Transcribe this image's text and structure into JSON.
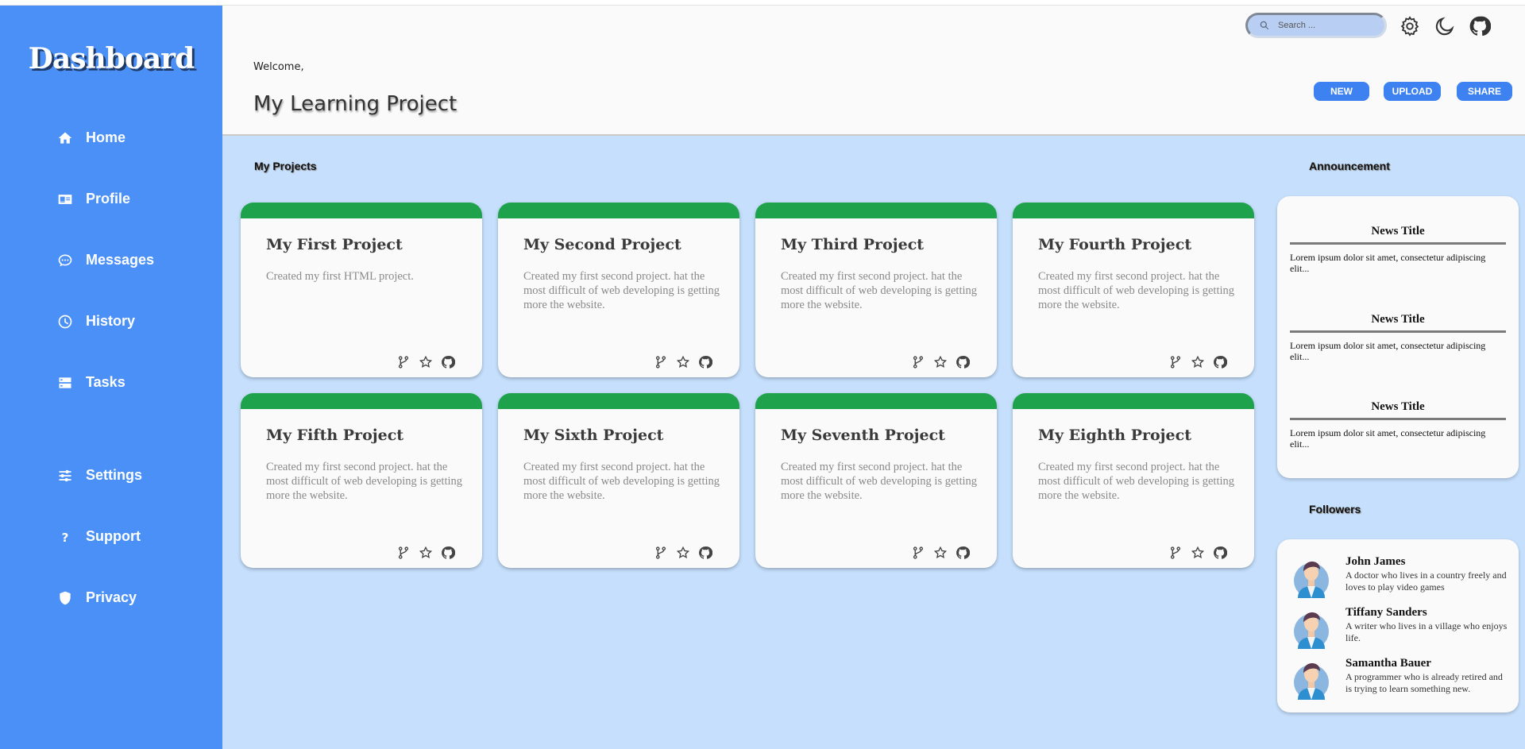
{
  "sidebar": {
    "logo": "Dashboard",
    "items": [
      {
        "label": "Home",
        "icon": "home-icon"
      },
      {
        "label": "Profile",
        "icon": "id-card-icon"
      },
      {
        "label": "Messages",
        "icon": "chat-icon"
      },
      {
        "label": "History",
        "icon": "clock-icon"
      },
      {
        "label": "Tasks",
        "icon": "tasks-icon"
      },
      {
        "label": "Settings",
        "icon": "sliders-icon"
      },
      {
        "label": "Support",
        "icon": "question-icon"
      },
      {
        "label": "Privacy",
        "icon": "shield-icon"
      }
    ]
  },
  "header": {
    "search_placeholder": "Search ...",
    "welcome": "Welcome,",
    "title": "My Learning Project",
    "buttons": [
      "NEW",
      "UPLOAD",
      "SHARE"
    ]
  },
  "projects": {
    "title": "My Projects",
    "items": [
      {
        "title": "My First Project",
        "desc": "Created my first HTML project."
      },
      {
        "title": "My Second Project",
        "desc": "Created my first second project. hat the most difficult of web developing is getting more the website."
      },
      {
        "title": "My Third Project",
        "desc": "Created my first second project. hat the most difficult of web developing is getting more the website."
      },
      {
        "title": "My Fourth Project",
        "desc": "Created my first second project. hat the most difficult of web developing is getting more the website."
      },
      {
        "title": "My Fifth Project",
        "desc": "Created my first second project. hat the most difficult of web developing is getting more the website."
      },
      {
        "title": "My Sixth Project",
        "desc": "Created my first second project. hat the most difficult of web developing is getting more the website."
      },
      {
        "title": "My Seventh Project",
        "desc": "Created my first second project. hat the most difficult of web developing is getting more the website."
      },
      {
        "title": "My Eighth Project",
        "desc": "Created my first second project. hat the most difficult of web developing is getting more the website."
      }
    ]
  },
  "announcement": {
    "title": "Announcement",
    "items": [
      {
        "title": "News Title",
        "body": "Lorem ipsum dolor sit amet, consectetur adipiscing elit..."
      },
      {
        "title": "News Title",
        "body": "Lorem ipsum dolor sit amet, consectetur adipiscing elit..."
      },
      {
        "title": "News Title",
        "body": "Lorem ipsum dolor sit amet, consectetur adipiscing elit..."
      }
    ]
  },
  "followers": {
    "title": "Followers",
    "items": [
      {
        "name": "John James",
        "desc": "A doctor who lives in a country freely and loves to play video games"
      },
      {
        "name": "Tiffany Sanders",
        "desc": "A writer who lives in a village who enjoys life."
      },
      {
        "name": "Samantha Bauer",
        "desc": "A programmer who is already retired and is trying to learn something new."
      }
    ]
  },
  "colors": {
    "sidebar": "#4a90f7",
    "background": "#c5dffc",
    "card_top": "#1ea34c",
    "button": "#3d82f0"
  }
}
